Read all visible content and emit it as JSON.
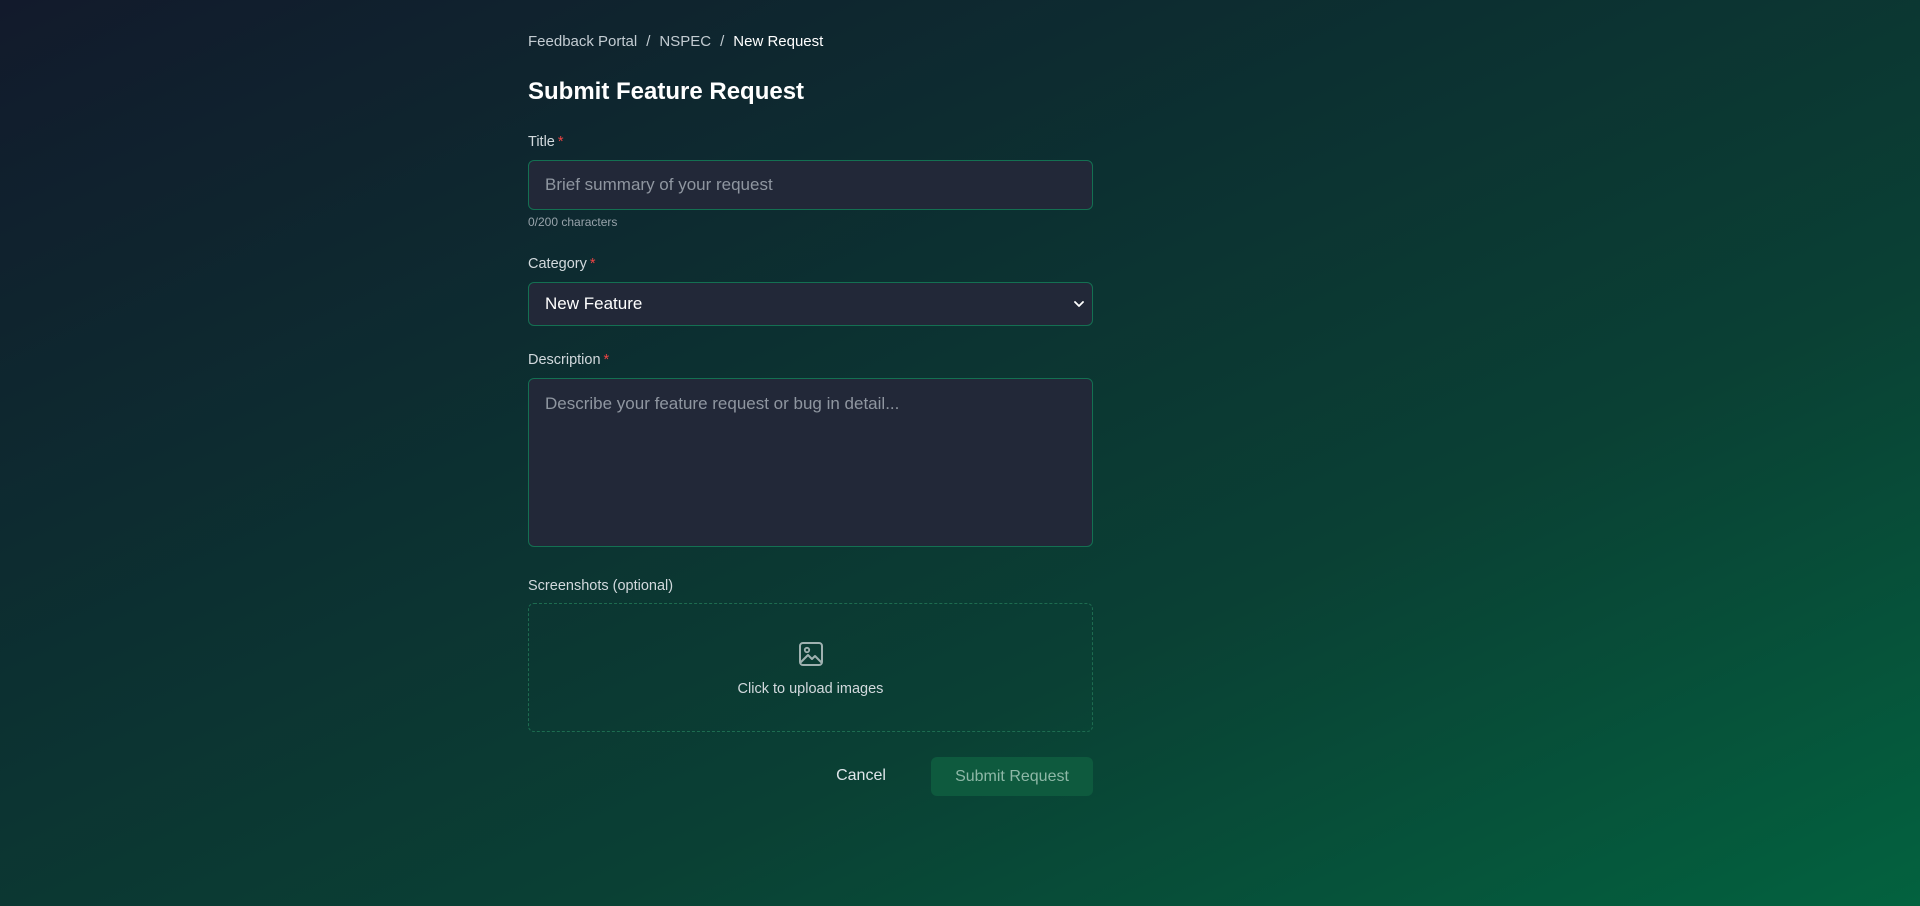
{
  "breadcrumb": {
    "items": [
      "Feedback Portal",
      "NSPEC"
    ],
    "current": "New Request",
    "separator": "/"
  },
  "page": {
    "title": "Submit Feature Request"
  },
  "form": {
    "title": {
      "label": "Title",
      "required_mark": "*",
      "placeholder": "Brief summary of your request",
      "value": "",
      "char_count": "0/200 characters"
    },
    "category": {
      "label": "Category",
      "required_mark": "*",
      "selected": "New Feature",
      "icon": "chevron-down-icon"
    },
    "description": {
      "label": "Description",
      "required_mark": "*",
      "placeholder": "Describe your feature request or bug in detail...",
      "value": ""
    },
    "screenshots": {
      "label": "Screenshots (optional)",
      "upload_text": "Click to upload images",
      "icon": "image-icon"
    }
  },
  "actions": {
    "cancel_label": "Cancel",
    "submit_label": "Submit Request"
  },
  "colors": {
    "accent_border": "#147052",
    "required": "#ef4444",
    "submit_bg": "#0e5a3e",
    "field_bg": "#222838"
  }
}
